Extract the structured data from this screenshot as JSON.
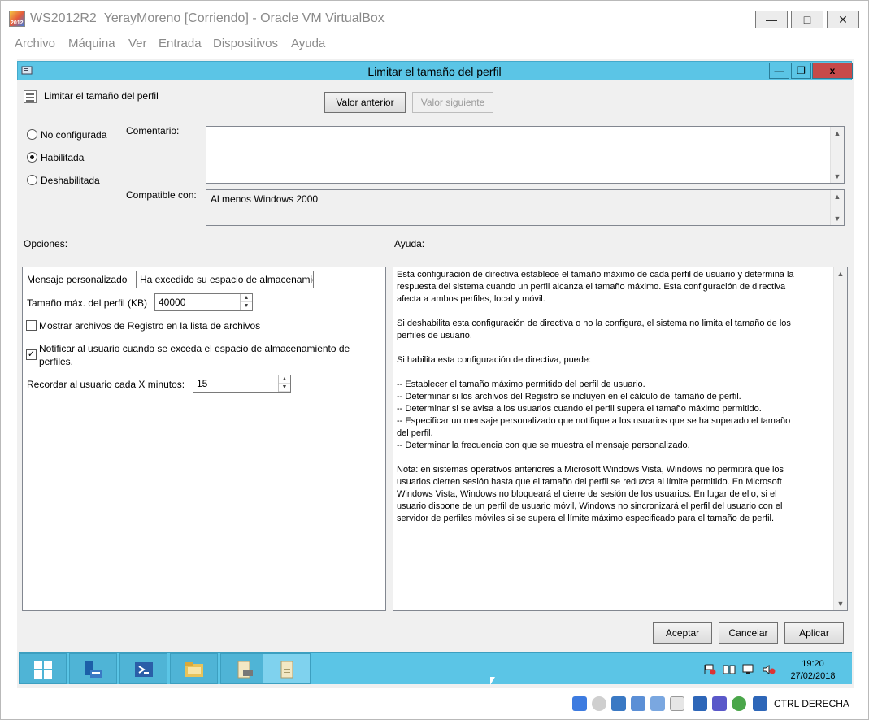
{
  "host": {
    "title": "WS2012R2_YerayMoreno [Corriendo] - Oracle VM VirtualBox",
    "icon_label": "2012",
    "controls": {
      "minimize": "—",
      "maximize": "□",
      "close": "✕"
    },
    "menu": [
      "Archivo",
      "Máquina",
      "Ver",
      "Entrada",
      "Dispositivos",
      "Ayuda"
    ],
    "status_text": "CTRL DERECHA"
  },
  "dialog": {
    "title": "Limitar el tamaño del perfil",
    "controls": {
      "minimize": "—",
      "restore": "❐",
      "close": "x"
    },
    "policy_name": "Limitar el tamaño del perfil",
    "prev_button": "Valor anterior",
    "next_button": "Valor siguiente",
    "radios": [
      {
        "label": "No configurada",
        "checked": false
      },
      {
        "label": "Habilitada",
        "checked": true
      },
      {
        "label": "Deshabilitada",
        "checked": false
      }
    ],
    "comment_label": "Comentario:",
    "comment_value": "",
    "compat_label": "Compatible con:",
    "compat_value": "Al menos Windows 2000",
    "options_label": "Opciones:",
    "help_label": "Ayuda:",
    "options": {
      "message_label": "Mensaje personalizado",
      "message_value": "Ha excedido su espacio de almacenamie",
      "max_size_label": "Tamaño máx. del perfil (KB)",
      "max_size_value": "40000",
      "show_registry_label": "Mostrar archivos de Registro en la lista de archivos",
      "show_registry_checked": false,
      "notify_label_1": "Notificar al usuario cuando se exceda el espacio de almacenamiento de",
      "notify_label_2": "perfiles.",
      "notify_checked": true,
      "notify_mark": "✓",
      "remind_label": "Recordar al usuario cada X minutos:",
      "remind_value": "15"
    },
    "help_text": "Esta configuración de directiva establece el tamaño máximo de cada perfil de usuario y determina la\nrespuesta del sistema cuando un perfil alcanza el tamaño máximo. Esta configuración de directiva\nafecta a ambos perfiles, local y móvil.\n\nSi deshabilita esta configuración de directiva o no la configura, el sistema no limita el tamaño de los\nperfiles de usuario.\n\nSi habilita esta configuración de directiva, puede:\n\n-- Establecer el tamaño máximo permitido del perfil de usuario.\n-- Determinar si los archivos del Registro se incluyen en el cálculo del tamaño de perfil.\n-- Determinar si se avisa a los usuarios cuando el perfil supera el tamaño máximo permitido.\n-- Especificar un mensaje personalizado que notifique a los usuarios que se ha superado el tamaño\ndel perfil.\n-- Determinar la frecuencia con que se muestra el mensaje personalizado.\n\nNota: en sistemas operativos anteriores a Microsoft Windows Vista, Windows no permitirá que los\nusuarios cierren sesión hasta que el tamaño del perfil se reduzca al límite permitido. En Microsoft\nWindows Vista, Windows no bloqueará el cierre de sesión de los usuarios. En lugar de ello, si el\nusuario dispone de un perfil de usuario móvil, Windows no sincronizará el perfil del usuario con el\nservidor de perfiles móviles si se supera el límite máximo especificado para el tamaño de perfil.",
    "accept_button": "Aceptar",
    "cancel_button": "Cancelar",
    "apply_button": "Aplicar"
  },
  "taskbar": {
    "time": "19:20",
    "date": "27/02/2018",
    "items": [
      "start",
      "server-manager",
      "powershell",
      "file-explorer",
      "policy-editor",
      "policy-setting"
    ]
  },
  "colors": {
    "taskbar": "#5bc5e6",
    "close": "#c74a4a"
  }
}
